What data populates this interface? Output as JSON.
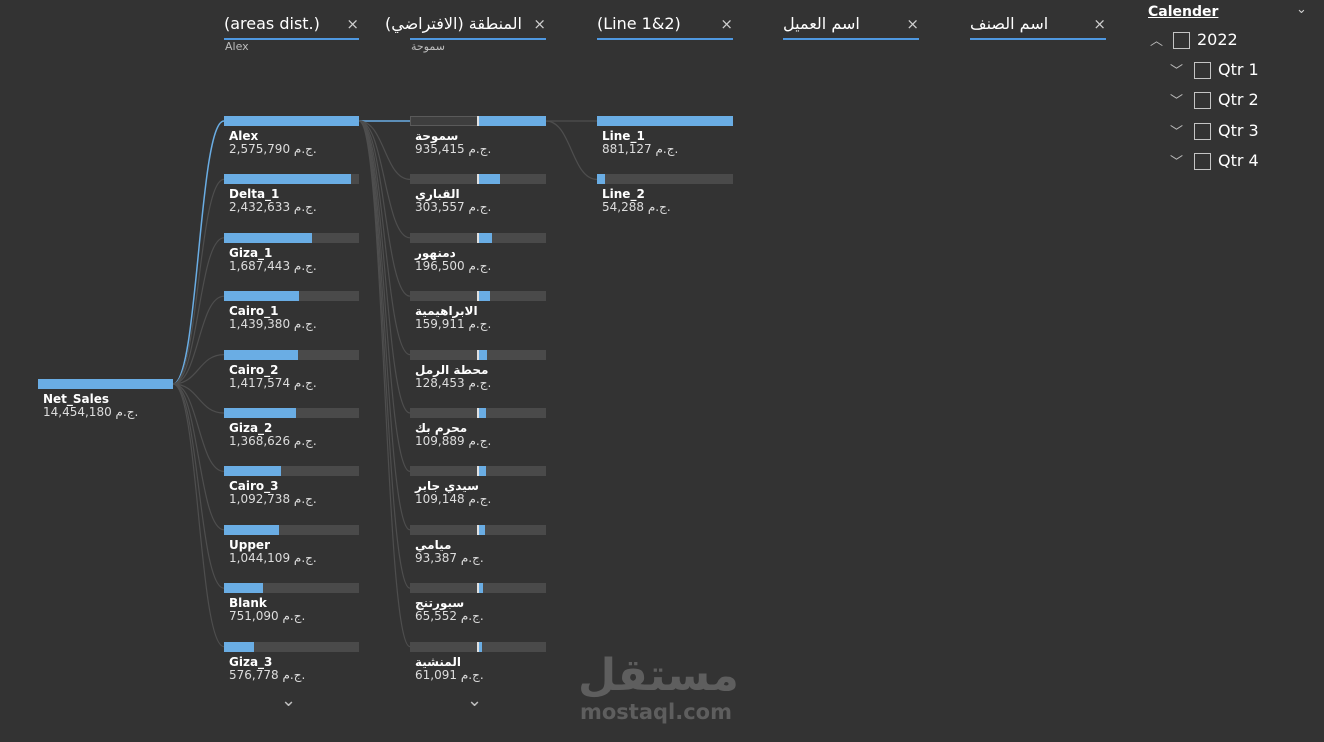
{
  "columns": [
    {
      "title": "(areas dist.)",
      "sub": "Alex"
    },
    {
      "title": "المنطقة (الافتراضي)",
      "sub": "سموحة"
    },
    {
      "title": "(Line 1&2)",
      "sub": ""
    },
    {
      "title": "اسم العميل",
      "sub": ""
    },
    {
      "title": "اسم الصنف",
      "sub": ""
    }
  ],
  "close_glyph": "×",
  "currency": "ج.م.",
  "root": {
    "name": "Net_Sales",
    "value": "14,454,180",
    "fraction": 1.0
  },
  "areas": [
    {
      "name": "Alex",
      "value": "2,575,790",
      "fraction": 1.0
    },
    {
      "name": "Delta_1",
      "value": "2,432,633",
      "fraction": 0.944
    },
    {
      "name": "Giza_1",
      "value": "1,687,443",
      "fraction": 0.655
    },
    {
      "name": "Cairo_1",
      "value": "1,439,380",
      "fraction": 0.559
    },
    {
      "name": "Cairo_2",
      "value": "1,417,574",
      "fraction": 0.55
    },
    {
      "name": "Giza_2",
      "value": "1,368,626",
      "fraction": 0.531
    },
    {
      "name": "Cairo_3",
      "value": "1,092,738",
      "fraction": 0.424
    },
    {
      "name": "Upper",
      "value": "1,044,109",
      "fraction": 0.405
    },
    {
      "name": "Blank",
      "value": "751,090",
      "fraction": 0.292
    },
    {
      "name": "Giza_3",
      "value": "576,778",
      "fraction": 0.224
    }
  ],
  "regions": [
    {
      "name": "سموحة",
      "value": "935,415",
      "fraction": 1.0
    },
    {
      "name": "القباري",
      "value": "303,557",
      "fraction": 0.324
    },
    {
      "name": "دمنهور",
      "value": "196,500",
      "fraction": 0.21
    },
    {
      "name": "الابراهيمية",
      "value": "159,911",
      "fraction": 0.171
    },
    {
      "name": "محطة الرمل",
      "value": "128,453",
      "fraction": 0.137
    },
    {
      "name": "محرم بك",
      "value": "109,889",
      "fraction": 0.117
    },
    {
      "name": "سيدي جابر",
      "value": "109,148",
      "fraction": 0.117
    },
    {
      "name": "ميامي",
      "value": "93,387",
      "fraction": 0.1
    },
    {
      "name": "سبورتنج",
      "value": "65,552",
      "fraction": 0.07
    },
    {
      "name": "المنشية",
      "value": "61,091",
      "fraction": 0.065
    }
  ],
  "lines": [
    {
      "name": "Line_1",
      "value": "881,127",
      "fraction": 1.0
    },
    {
      "name": "Line_2",
      "value": "54,288",
      "fraction": 0.062
    }
  ],
  "more_glyph": "⌄",
  "slicer": {
    "title": "Calender",
    "collapse_glyph": "⌄",
    "year": {
      "label": "2022",
      "expanded": true
    },
    "quarters": [
      {
        "label": "Qtr 1"
      },
      {
        "label": "Qtr 2"
      },
      {
        "label": "Qtr 3"
      },
      {
        "label": "Qtr 4"
      }
    ],
    "expanded_glyph": "︿",
    "collapsed_glyph": "﹀"
  },
  "watermark": {
    "logo": "مستقل",
    "domain": "mostaql.com"
  },
  "colors": {
    "background": "#333333",
    "bar_fill": "#6aade4",
    "bar_track": "#4a4a4a",
    "accent_line": "#4f98e0"
  }
}
